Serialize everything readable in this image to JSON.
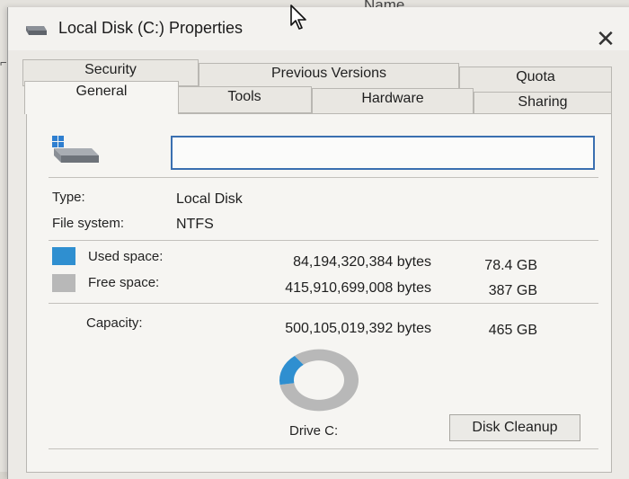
{
  "background": {
    "column_header": "Name"
  },
  "dialog": {
    "title": "Local Disk (C:) Properties",
    "close_glyph": "✕",
    "tabs": [
      {
        "label": "Security",
        "row": "back"
      },
      {
        "label": "Previous Versions",
        "row": "back"
      },
      {
        "label": "Quota",
        "row": "back"
      },
      {
        "label": "General",
        "row": "front",
        "active": true
      },
      {
        "label": "Tools",
        "row": "front"
      },
      {
        "label": "Hardware",
        "row": "front"
      },
      {
        "label": "Sharing",
        "row": "front"
      }
    ],
    "drive_name_value": "",
    "type_label": "Type:",
    "type_value": "Local Disk",
    "fs_label": "File system:",
    "fs_value": "NTFS",
    "used": {
      "label": "Used space:",
      "bytes": "84,194,320,384 bytes",
      "size": "78.4 GB",
      "color": "#2f8fd0"
    },
    "free": {
      "label": "Free space:",
      "bytes": "415,910,699,008 bytes",
      "size": "387 GB",
      "color": "#b8b8b8"
    },
    "capacity": {
      "label": "Capacity:",
      "bytes": "500,105,019,392 bytes",
      "size": "465 GB"
    },
    "used_fraction": 0.168,
    "drive_caption": "Drive C:",
    "cleanup_label": "Disk Cleanup"
  }
}
